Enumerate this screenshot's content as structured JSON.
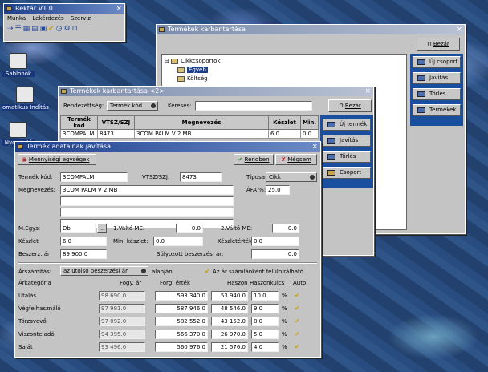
{
  "launcher": {
    "title": "Rektár V1.0",
    "menu": [
      "Munka",
      "Lekérdezés",
      "Szerviz"
    ]
  },
  "desktop": [
    {
      "label": "Sablonok"
    },
    {
      "label": "omatikus Indítás"
    },
    {
      "label": "Nyomtató"
    }
  ],
  "win1": {
    "title": "Termékek karbantartása",
    "tree": {
      "root": "Cikkcsoportok",
      "items": [
        "Egyéb",
        "Költség"
      ]
    },
    "close": "Bezár",
    "side": [
      "Új csoport",
      "Javítás",
      "Törlés",
      "Termékek"
    ]
  },
  "win2": {
    "title": "Termékek karbantartása <2>",
    "sort_label": "Rendezettség:",
    "sort_value": "Termék kód",
    "search_label": "Keresés:",
    "search_value": "",
    "close": "Bezár",
    "table": {
      "headers": [
        "Termék kód",
        "VTSZ/SZJ",
        "Megnevezés",
        "Készlet",
        "Min."
      ],
      "rows": [
        [
          "3COMPALM",
          "8473",
          "3COM PALM V 2 MB",
          "6.0",
          "0.0"
        ]
      ]
    },
    "side": [
      "Új termék",
      "Javítás",
      "Törlés",
      "Csoport"
    ]
  },
  "win3": {
    "title": "Termék adatainak javítása",
    "btn_units": "Mennyiségi egységek",
    "btn_ok": "Rendben",
    "btn_cancel": "Mégsem",
    "code_label": "Termék kód:",
    "code": "3COMPALM",
    "vtsz_label": "VTSZ/SZJ:",
    "vtsz": "8473",
    "type_label": "Típusa:",
    "type": "Cikk",
    "name_label": "Megnevezés:",
    "name": "3COM PALM V 2 MB",
    "vat_label": "ÁFA %:",
    "vat": "25.0",
    "unit_label": "M.Egys:",
    "unit": "Db",
    "unit_btn": "...",
    "alt1_label": "1.Váltó ME:",
    "alt1": "0.0",
    "alt2_label": "2.Váltó ME:",
    "alt2": "0.0",
    "stock_label": "Készlet",
    "stock": "6.0",
    "minstock_label": "Min. készlet:",
    "minstock": "0.0",
    "stockval_label": "Készletérték:",
    "stockval": "0.0",
    "buyprice_label": "Beszerz. ár",
    "buyprice": "89 900.0",
    "weighted_label": "Súlyozott beszerzési ár:",
    "weighted": "0.0",
    "pricing_label": "Árszámítás:",
    "pricing_value": "az utolsó beszerzési ár",
    "pricing_suffix": "alapján",
    "override_label": "Az ár számlánként felülbírálható",
    "price_headers": [
      "Árkategória",
      "Fogy. ár",
      "Forg. érték",
      "Haszon",
      "Haszonkulcs",
      "Auto"
    ],
    "price_rows": [
      {
        "cat": "Utalás",
        "fogy": "98 690.0",
        "forg": "593 340.0",
        "haszon": "53 940.0",
        "kulcs": "10.0",
        "pct": "%"
      },
      {
        "cat": "Végfelhasználó",
        "fogy": "97 991.0",
        "forg": "587 946.0",
        "haszon": "48 546.0",
        "kulcs": "9.0",
        "pct": "%"
      },
      {
        "cat": "Törzsvevő",
        "fogy": "97 092.0",
        "forg": "582 552.0",
        "haszon": "43 152.0",
        "kulcs": "8.0",
        "pct": "%"
      },
      {
        "cat": "Viszonteladó",
        "fogy": "94 395.0",
        "forg": "566 370.0",
        "haszon": "26 970.0",
        "kulcs": "5.0",
        "pct": "%"
      },
      {
        "cat": "Saját",
        "fogy": "93 496.0",
        "forg": "560 976.0",
        "haszon": "21 576.0",
        "kulcs": "4.0",
        "pct": "%"
      }
    ]
  }
}
